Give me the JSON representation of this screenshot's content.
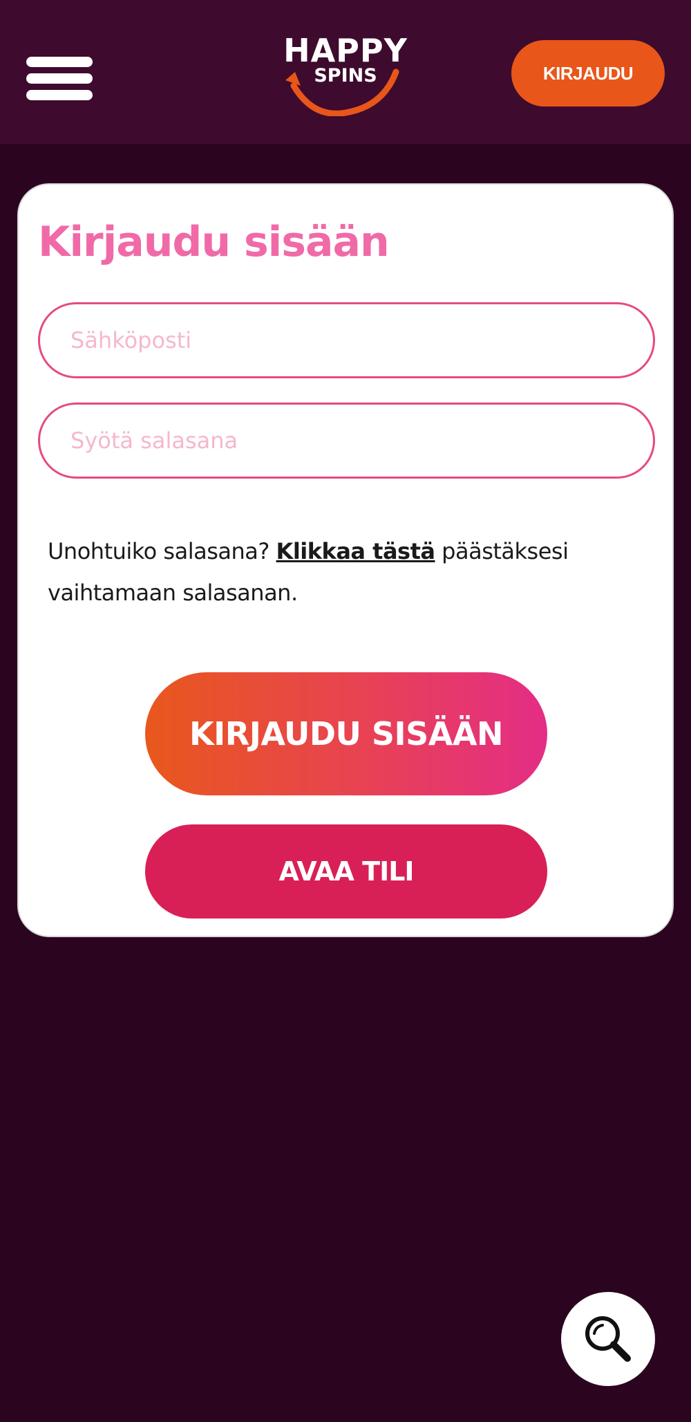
{
  "header": {
    "menu_icon": "hamburger-menu-icon",
    "logo": {
      "line1": "HAPPY",
      "line2": "SPINS"
    },
    "login_label": "KIRJAUDU"
  },
  "login_card": {
    "title": "Kirjaudu sisään",
    "email_placeholder": "Sähköposti",
    "password_placeholder": "Syötä salasana",
    "forgot": {
      "prefix": "Unohtuiko salasana? ",
      "link": "Klikkaa tästä",
      "suffix": " päästäksesi vaihtamaan salasanan."
    },
    "login_button": "KIRJAUDU SISÄÄN",
    "register_button": "AVAA TILI"
  },
  "search_fab": {
    "icon": "search-icon"
  },
  "colors": {
    "background": "#2b0420",
    "header_bg": "#3e0a2e",
    "accent_orange": "#e8561a",
    "accent_pink": "#f06aa8",
    "field_border": "#e64a82",
    "register_bg": "#d82057"
  }
}
